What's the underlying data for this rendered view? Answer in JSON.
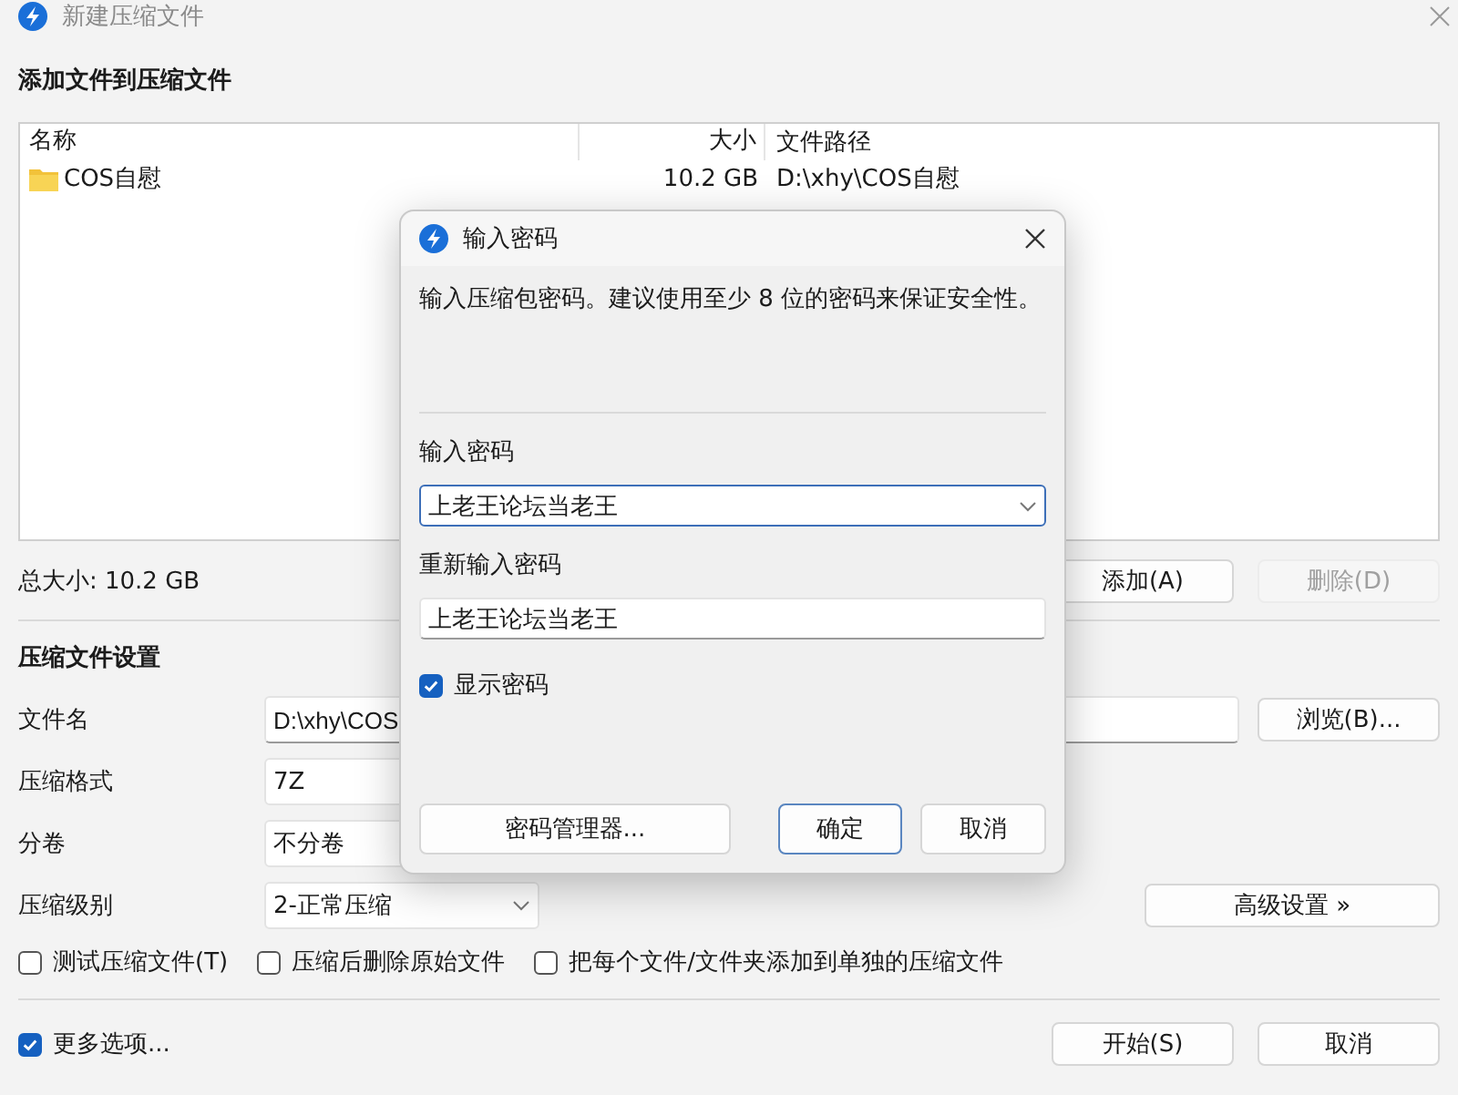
{
  "window": {
    "title": "新建压缩文件"
  },
  "files_section": {
    "heading": "添加文件到压缩文件",
    "columns": [
      "名称",
      "大小",
      "文件路径"
    ],
    "rows": [
      {
        "kind": "folder",
        "name": "COS自慰",
        "size": "10.2 GB",
        "path": "D:\\xhy\\COS自慰"
      }
    ],
    "total": "总大小: 10.2 GB",
    "buttons": [
      {
        "label": "添加(A)",
        "disabled": false
      },
      {
        "label": "删除(D)",
        "disabled": true
      }
    ]
  },
  "settings": {
    "heading": "压缩文件设置",
    "fields": [
      {
        "kind": "text",
        "label": "文件名",
        "value": "D:\\xhy\\COS"
      },
      {
        "kind": "box",
        "label": "压缩格式",
        "value": "7Z"
      },
      {
        "kind": "box",
        "label": "分卷",
        "value": "不分卷"
      },
      {
        "kind": "dropdown",
        "label": "压缩级别",
        "value": "2-正常压缩"
      }
    ],
    "browse_button": "浏览(B)...",
    "advanced_button": "高级设置 »",
    "options": [
      {
        "label": "测试压缩文件(T)",
        "checked": false
      },
      {
        "label": "压缩后删除原始文件",
        "checked": false
      },
      {
        "label": "把每个文件/文件夹添加到单独的压缩文件",
        "checked": false
      }
    ]
  },
  "footer": {
    "more_options": {
      "label": "更多选项...",
      "checked": true
    },
    "buttons": [
      "开始(S)",
      "取消"
    ]
  },
  "dialog": {
    "title": "输入密码",
    "description": "输入压缩包密码。建议使用至少 8 位的密码来保证安全性。",
    "fields": [
      {
        "kind": "dropdown",
        "label": "输入密码",
        "value": "上老王论坛当老王",
        "focused": true
      },
      {
        "kind": "text",
        "label": "重新输入密码",
        "value": "上老王论坛当老王",
        "focused": false
      }
    ],
    "show_password": {
      "label": "显示密码",
      "checked": true
    },
    "manager_button": "密码管理器...",
    "buttons": [
      {
        "label": "确定",
        "default": true
      },
      {
        "label": "取消",
        "default": false
      }
    ]
  }
}
